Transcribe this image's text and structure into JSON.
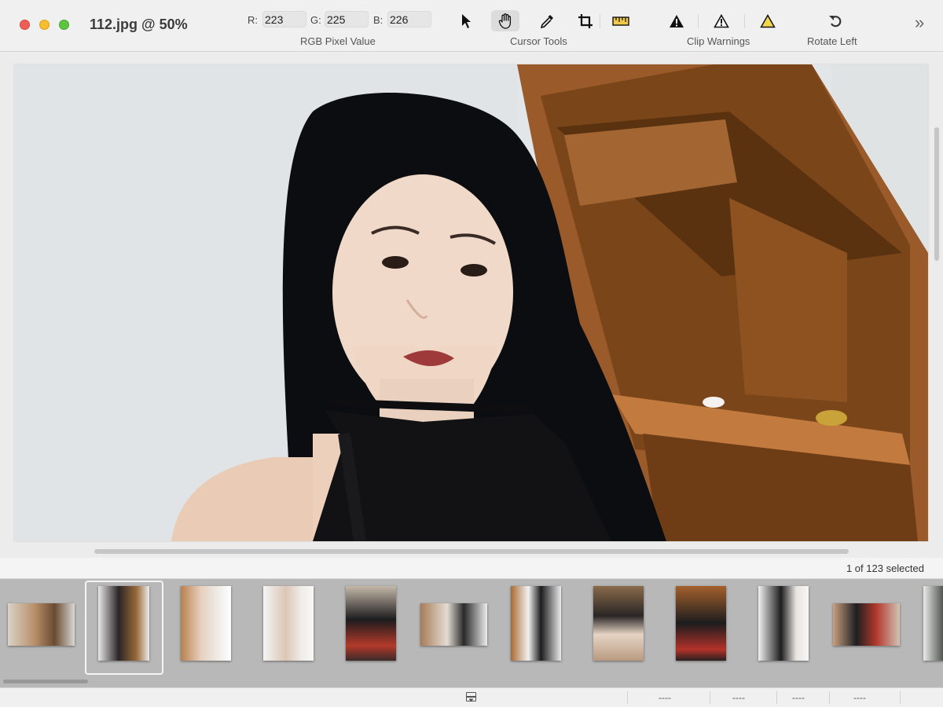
{
  "window": {
    "title": "112.jpg @ 50%"
  },
  "rgb": {
    "r_label": "R:",
    "r_value": "223",
    "g_label": "G:",
    "g_value": "225",
    "b_label": "B:",
    "b_value": "226",
    "group_label": "RGB Pixel Value"
  },
  "cursor_tools": {
    "label": "Cursor Tools",
    "items": [
      "arrow-cursor-icon",
      "hand-pan-icon",
      "eyedropper-icon",
      "crop-icon",
      "ruler-icon"
    ],
    "active": "hand-pan-icon"
  },
  "clip_warnings": {
    "label": "Clip Warnings",
    "items": [
      "black-warning-icon",
      "outline-warning-icon",
      "yellow-warning-icon"
    ]
  },
  "rotate": {
    "label": "Rotate Left",
    "icon": "rotate-left-icon"
  },
  "overflow": {
    "glyph": "»"
  },
  "status": {
    "selection": "1 of 123 selected"
  },
  "bottom_bar": {
    "field1": "----",
    "field2": "----",
    "field3": "----",
    "field4": "----"
  },
  "colors": {
    "toolbar_bg": "#f0f0f0",
    "filmstrip_bg": "#b8b8b8",
    "selection_border": "#f4f4f4"
  }
}
